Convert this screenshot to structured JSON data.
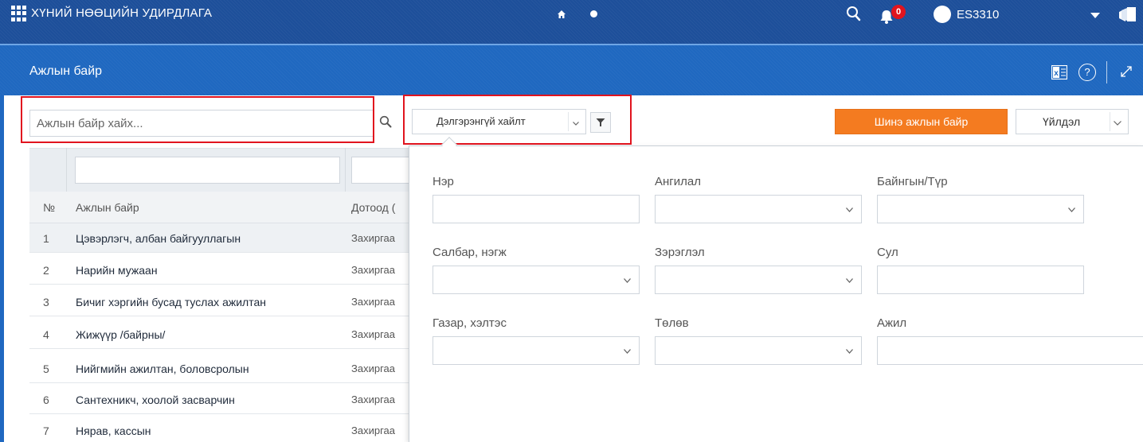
{
  "header": {
    "app_title": "ХҮНИЙ НӨӨЦИЙН УДИРДЛАГА",
    "notification_count": "0",
    "username": "ES3310",
    "icons": [
      "apps-grid-icon",
      "home-icon",
      "dot-icon",
      "search-icon",
      "bell-icon",
      "user-avatar-icon",
      "chevron-down-icon",
      "layers-icon"
    ]
  },
  "titlebar": {
    "title": "Ажлын байр",
    "help_label": "?",
    "icons": [
      "excel-export-icon",
      "help-icon",
      "expand-icon"
    ]
  },
  "toolbar": {
    "search_placeholder": "Ажлын байр хайх...",
    "advanced_search_label": "Дэлгэрэнгүй хайлт",
    "new_button_label": "Шинэ ажлын байр",
    "action_button_label": "Үйлдэл"
  },
  "table": {
    "columns": [
      "№",
      "Ажлын байр",
      "Дотоод ("
    ],
    "rows": [
      {
        "no": "1",
        "name": "Цэвэрлэгч, албан байгууллагын",
        "category": "Захиргаа"
      },
      {
        "no": "2",
        "name": "Нарийн мужаан",
        "category": "Захиргаа"
      },
      {
        "no": "3",
        "name": "Бичиг хэргийн бусад туслах ажилтан",
        "category": "Захиргаа"
      },
      {
        "no": "4",
        "name": "Жижүүр /байрны/",
        "category": "Захиргаа"
      },
      {
        "no": "5",
        "name": "Нийгмийн ажилтан, боловсролын",
        "category": "Захиргаа"
      },
      {
        "no": "6",
        "name": "Сантехникч, хоолой засварчин",
        "category": "Захиргаа"
      },
      {
        "no": "7",
        "name": "Нярав, кассын",
        "category": "Захиргаа"
      }
    ]
  },
  "advanced_search": {
    "fields": {
      "name": {
        "label": "Нэр",
        "value": ""
      },
      "category": {
        "label": "Ангилал",
        "value": ""
      },
      "type": {
        "label": "Байнгын/Түр",
        "value": ""
      },
      "branch": {
        "label": "Салбар, нэгж",
        "value": ""
      },
      "rank": {
        "label": "Зэрэглэл",
        "value": ""
      },
      "vacant": {
        "label": "Сул",
        "value": ""
      },
      "department": {
        "label": "Газар, хэлтэс",
        "value": ""
      },
      "status": {
        "label": "Төлөв",
        "value": ""
      },
      "job": {
        "label": "Ажил",
        "value": ""
      }
    }
  },
  "colors": {
    "header_bg": "#1d4f9a",
    "titlebar_bg": "#1f68c0",
    "primary_button": "#f47b20",
    "highlight_border": "#e1141e",
    "badge": "#e0141e"
  }
}
